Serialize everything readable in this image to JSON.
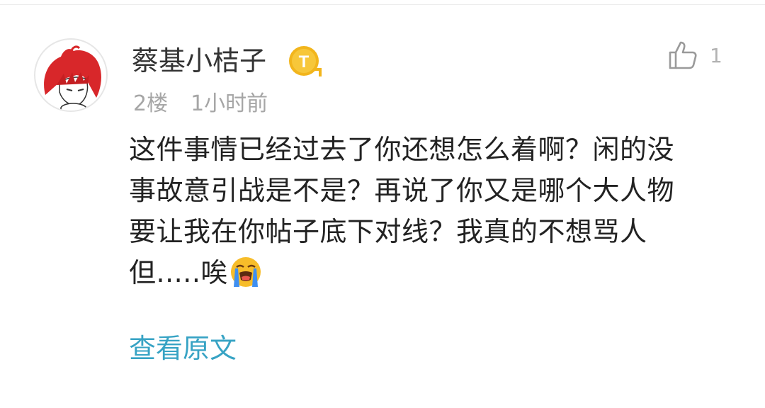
{
  "comment": {
    "username": "蔡基小桔子",
    "badge_letter": "T",
    "floor": "2楼",
    "time": "1小时前",
    "like_count": "1",
    "content_lines": [
      "这件事情已经过去了你还想怎么着啊？闲的没",
      "事故意引战是不是？再说了你又是哪个大人物",
      "要让我在你帖子底下对线？我真的不想骂人",
      "但.....唉"
    ],
    "emoji": "loudly-crying-face",
    "view_original_label": "查看原文"
  },
  "colors": {
    "username": "#333333",
    "meta": "#a6a6a6",
    "link": "#37a3c4",
    "badge_gold": "#f2b51c"
  }
}
